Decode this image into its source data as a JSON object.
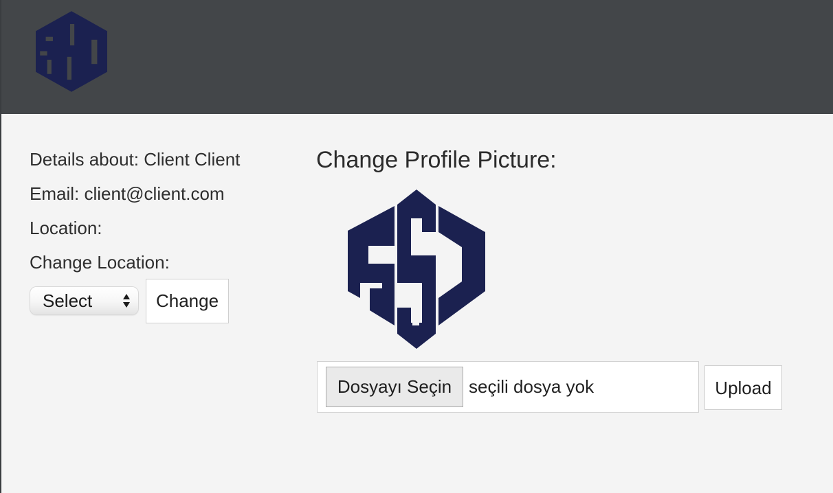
{
  "header": {
    "logo_icon": "ssc-logo-icon",
    "logo_color": "#1b2150",
    "background": "#434649"
  },
  "details": {
    "name_line": "Details about: Client Client",
    "email_line": "Email: client@client.com",
    "location_line": "Location:",
    "change_location_label": "Change Location:"
  },
  "location_form": {
    "select_value": "Select",
    "change_label": "Change"
  },
  "profile_picture": {
    "title": "Change Profile Picture:",
    "image_icon": "ssc-logo-icon",
    "file_button_label": "Dosyayı Seçin",
    "file_status": "seçili dosya yok",
    "upload_label": "Upload"
  }
}
